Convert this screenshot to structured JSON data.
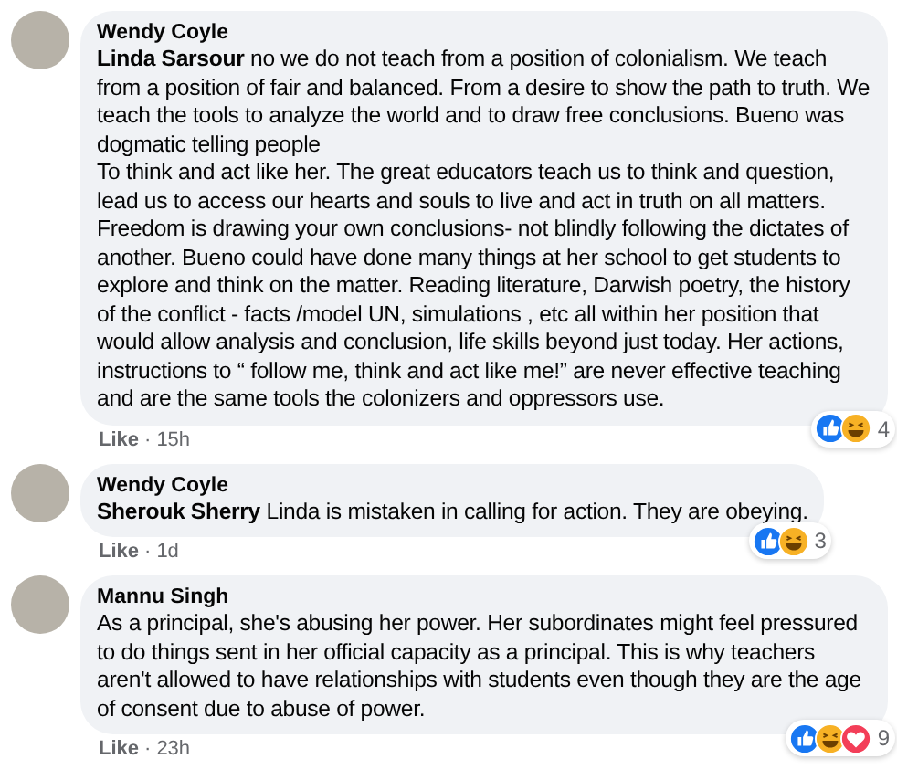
{
  "comments": [
    {
      "author": "Wendy Coyle",
      "text": "**Linda Sarsour** no we do not teach from a position of colonialism. We teach from a position of fair and balanced. From a desire to show the path to truth. We teach the tools to analyze the world and to draw free conclusions. Bueno was dogmatic telling people\nTo think and act like her. The great educators teach us to think and question, lead us to access our hearts and souls to live and act in truth on all matters. Freedom is drawing your own conclusions- not blindly following the dictates of another. Bueno could have done many things at her school to get students to explore and think on the matter. Reading literature, Darwish poetry, the history of the conflict - facts /model UN, simulations , etc all within her position that would allow analysis and conclusion, life skills beyond just today. Her actions, instructions to “ follow me, think and act like me!” are never effective teaching and are the same tools the colonizers and oppressors use.",
      "like": "Like",
      "separator": "·",
      "time": "15h",
      "reactions": [
        {
          "kind": "like"
        },
        {
          "kind": "haha"
        }
      ],
      "count": "4"
    },
    {
      "author": "Wendy Coyle",
      "text": "**Sherouk Sherry** Linda is mistaken in calling for action. They are obeying.",
      "like": "Like",
      "separator": "·",
      "time": "1d",
      "reactions": [
        {
          "kind": "like"
        },
        {
          "kind": "haha"
        }
      ],
      "count": "3"
    },
    {
      "author": "Mannu Singh",
      "text": "As a principal, she's abusing her power. Her subordinates might feel pressured to do things sent in her official capacity as a principal. This is why teachers aren't allowed to have relationships with students even though they are the age of consent due to abuse of power.",
      "like": "Like",
      "separator": "·",
      "time": "23h",
      "reactions": [
        {
          "kind": "like"
        },
        {
          "kind": "haha"
        },
        {
          "kind": "love"
        }
      ],
      "count": "9"
    }
  ]
}
